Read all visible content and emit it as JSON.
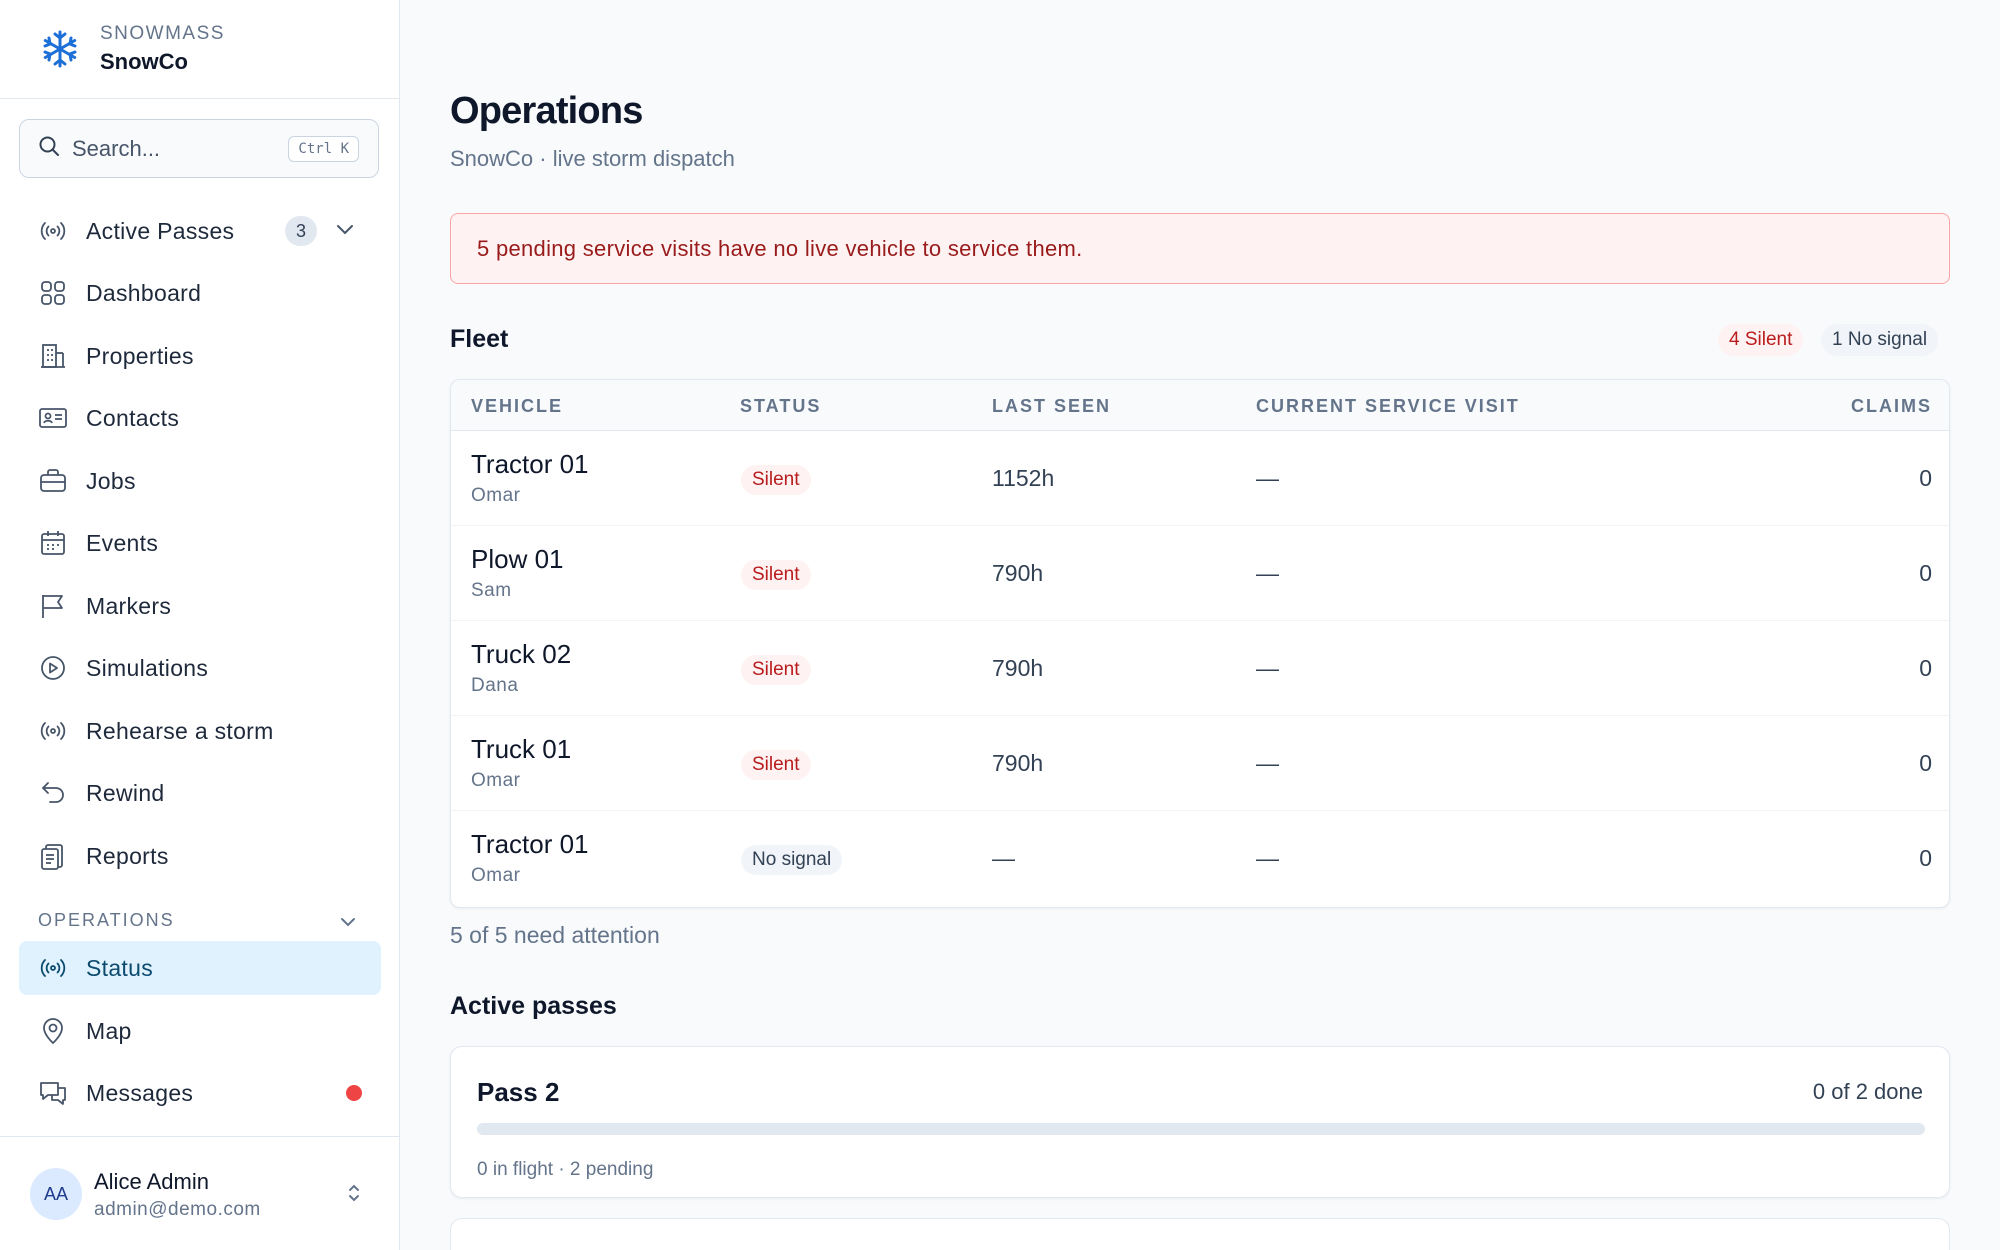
{
  "brand": {
    "org": "SNOWMASS",
    "name": "SnowCo"
  },
  "search": {
    "placeholder": "Search...",
    "shortcut": "Ctrl K"
  },
  "sidebar": {
    "items": [
      {
        "label": "Active Passes",
        "icon": "broadcast-icon",
        "badge": "3"
      },
      {
        "label": "Dashboard",
        "icon": "grid-icon"
      },
      {
        "label": "Properties",
        "icon": "building-icon"
      },
      {
        "label": "Contacts",
        "icon": "id-card-icon"
      },
      {
        "label": "Jobs",
        "icon": "briefcase-icon"
      },
      {
        "label": "Events",
        "icon": "calendar-icon"
      },
      {
        "label": "Markers",
        "icon": "flag-icon"
      },
      {
        "label": "Simulations",
        "icon": "play-circle-icon"
      },
      {
        "label": "Rehearse a storm",
        "icon": "broadcast-icon"
      },
      {
        "label": "Rewind",
        "icon": "undo-icon"
      },
      {
        "label": "Reports",
        "icon": "clipboard-icon"
      }
    ],
    "section_label": "OPERATIONS",
    "ops_items": [
      {
        "label": "Status",
        "icon": "broadcast-icon",
        "active": true
      },
      {
        "label": "Map",
        "icon": "map-pin-icon"
      },
      {
        "label": "Messages",
        "icon": "chat-icon",
        "unread": true
      }
    ]
  },
  "user": {
    "initials": "AA",
    "name": "Alice Admin",
    "email": "admin@demo.com"
  },
  "page": {
    "title": "Operations",
    "subtitle": "SnowCo · live storm dispatch"
  },
  "alert": {
    "text": "5 pending service visits have no live vehicle to service them."
  },
  "fleet": {
    "heading": "Fleet",
    "pill_silent": "4 Silent",
    "pill_no_signal": "1 No signal",
    "columns": [
      "VEHICLE",
      "STATUS",
      "LAST SEEN",
      "CURRENT SERVICE VISIT",
      "CLAIMS"
    ],
    "rows": [
      {
        "vehicle": "Tractor 01",
        "driver": "Omar",
        "status": "Silent",
        "last_seen": "1152h",
        "visit": "—",
        "claims": "0"
      },
      {
        "vehicle": "Plow 01",
        "driver": "Sam",
        "status": "Silent",
        "last_seen": "790h",
        "visit": "—",
        "claims": "0"
      },
      {
        "vehicle": "Truck 02",
        "driver": "Dana",
        "status": "Silent",
        "last_seen": "790h",
        "visit": "—",
        "claims": "0"
      },
      {
        "vehicle": "Truck 01",
        "driver": "Omar",
        "status": "Silent",
        "last_seen": "790h",
        "visit": "—",
        "claims": "0"
      },
      {
        "vehicle": "Tractor 01",
        "driver": "Omar",
        "status": "No signal",
        "last_seen": "—",
        "visit": "—",
        "claims": "0"
      }
    ],
    "attention": "5 of 5 need attention"
  },
  "passes": {
    "heading": "Active passes",
    "items": [
      {
        "name": "Pass 2",
        "done": "0 of 2 done",
        "progress": 0,
        "meta": "0 in flight · 2 pending"
      }
    ]
  },
  "colors": {
    "accent": "#1d6fd8",
    "danger": "#b91c1c",
    "active_bg": "#e0f2fe"
  }
}
